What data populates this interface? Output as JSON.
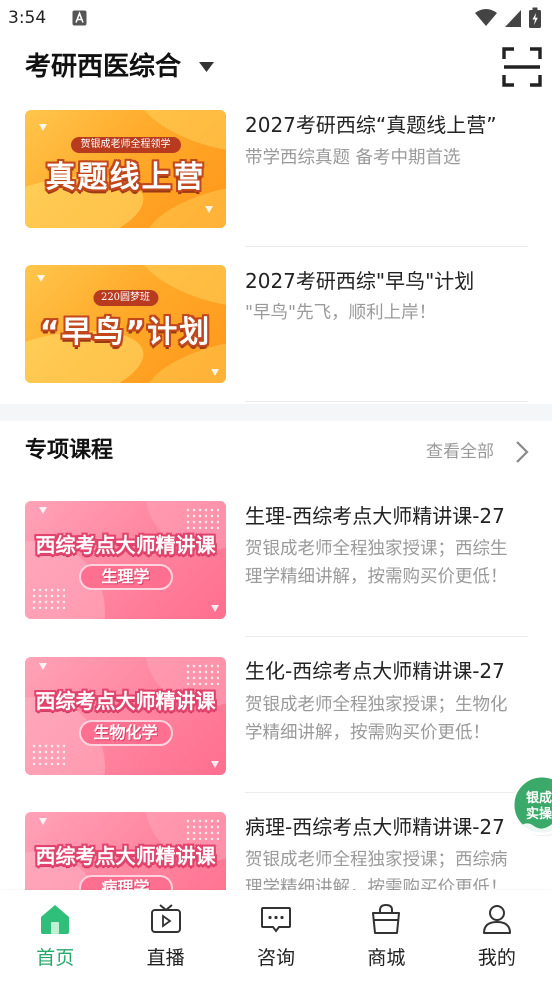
{
  "status_bar": {
    "time": "3:54",
    "icons": [
      "a-notification-icon",
      "wifi-icon",
      "signal-icon",
      "battery-charging-icon"
    ]
  },
  "header": {
    "title": "考研西医综合",
    "icons": [
      "chevron-down-icon",
      "scan-icon"
    ]
  },
  "featured": [
    {
      "thumb": {
        "banner": "贺银成老师全程领学",
        "headline": "真题线上营"
      },
      "title": "2027考研西综“真题线上营”",
      "subtitle": "带学西综真题  备考中期首选"
    },
    {
      "thumb": {
        "banner": "220圆梦班",
        "headline": "“早鸟”计划"
      },
      "title": "2027考研西综\"早鸟\"计划",
      "subtitle": "\"早鸟\"先飞，顺利上岸！"
    }
  ],
  "section": {
    "title": "专项课程",
    "view_all": "查看全部"
  },
  "courses": [
    {
      "thumb": {
        "headline": "西综考点大师精讲课",
        "pill": "生理学"
      },
      "title": "生理-西综考点大师精讲课-27",
      "subtitle": "贺银成老师全程独家授课；西综生理学精细讲解，按需购买价更低！"
    },
    {
      "thumb": {
        "headline": "西综考点大师精讲课",
        "pill": "生物化学"
      },
      "title": "生化-西综考点大师精讲课-27",
      "subtitle": " 贺银成老师全程独家授课；生物化学精细讲解，按需购买价更低！"
    },
    {
      "thumb": {
        "headline": "西综考点大师精讲课",
        "pill": "病理学"
      },
      "title": "病理-西综考点大师精讲课-27",
      "subtitle": "贺银成老师全程独家授课；西综病理学精细讲解，按需购买价更低！"
    }
  ],
  "floating_badge": {
    "line1": "银成",
    "line2": "实操"
  },
  "bottom_nav": [
    {
      "label": "首页",
      "icon": "home-icon",
      "active": true
    },
    {
      "label": "直播",
      "icon": "live-tv-icon",
      "active": false
    },
    {
      "label": "咨询",
      "icon": "chat-icon",
      "active": false
    },
    {
      "label": "商城",
      "icon": "shopping-bag-icon",
      "active": false
    },
    {
      "label": "我的",
      "icon": "user-icon",
      "active": false
    }
  ],
  "colors": {
    "accent": "#27a86a",
    "text_primary": "#222222",
    "text_secondary": "#9a9a9a",
    "orange_thumb": "#ffaa2a",
    "pink_thumb": "#ff86a0",
    "badge_green": "#3aa96a"
  }
}
